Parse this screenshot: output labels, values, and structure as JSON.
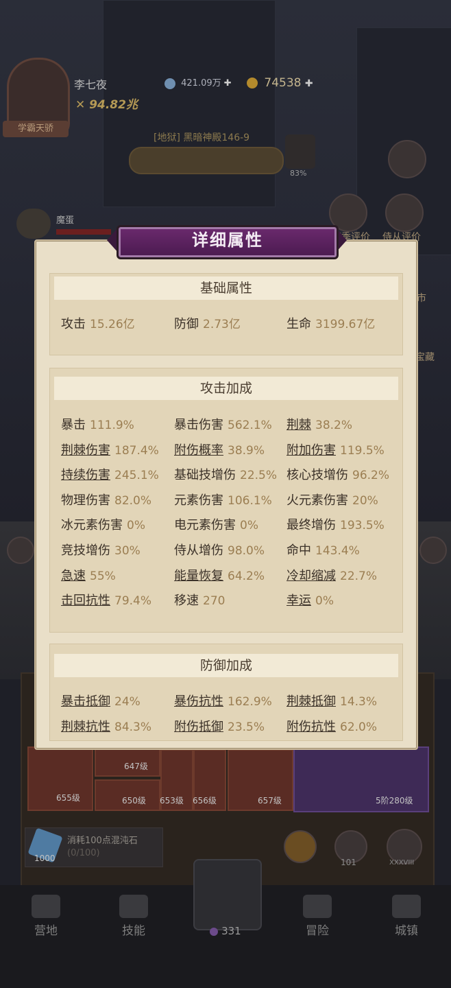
{
  "player": {
    "name": "李七夜",
    "power": "94.82兆",
    "badge": "学霸天骄"
  },
  "currency": {
    "diamond": "421.09万",
    "gold": "74538"
  },
  "stage": {
    "title": "[地狱] 黑暗神殿146-9",
    "progress_text": "83%"
  },
  "enemy": {
    "name": "魔蛋"
  },
  "side_labels": {
    "season": "赛季评价",
    "servant": "侍从评价",
    "shop": "市",
    "treasure": "宝藏"
  },
  "modal": {
    "title": "详细属性",
    "basic": {
      "heading": "基础属性",
      "stats": [
        {
          "label": "攻击",
          "value": "15.26亿"
        },
        {
          "label": "防御",
          "value": "2.73亿"
        },
        {
          "label": "生命",
          "value": "3199.67亿"
        }
      ]
    },
    "attack": {
      "heading": "攻击加成",
      "stats": [
        {
          "label": "暴击",
          "value": "111.9%"
        },
        {
          "label": "暴击伤害",
          "value": "562.1%"
        },
        {
          "label": "荆棘",
          "value": "38.2%"
        },
        {
          "label": "荆棘伤害",
          "value": "187.4%"
        },
        {
          "label": "附伤概率",
          "value": "38.9%"
        },
        {
          "label": "附加伤害",
          "value": "119.5%"
        },
        {
          "label": "持续伤害",
          "value": "245.1%"
        },
        {
          "label": "基础技增伤",
          "value": "22.5%"
        },
        {
          "label": "核心技增伤",
          "value": "96.2%"
        },
        {
          "label": "物理伤害",
          "value": "82.0%"
        },
        {
          "label": "元素伤害",
          "value": "106.1%"
        },
        {
          "label": "火元素伤害",
          "value": "20%"
        },
        {
          "label": "冰元素伤害",
          "value": "0%"
        },
        {
          "label": "电元素伤害",
          "value": "0%"
        },
        {
          "label": "最终增伤",
          "value": "193.5%"
        },
        {
          "label": "竞技增伤",
          "value": "30%"
        },
        {
          "label": "侍从增伤",
          "value": "98.0%"
        },
        {
          "label": "命中",
          "value": "143.4%"
        },
        {
          "label": "急速",
          "value": "55%"
        },
        {
          "label": "能量恢复",
          "value": "64.2%"
        },
        {
          "label": "冷却缩减",
          "value": "22.7%"
        },
        {
          "label": "击回抗性",
          "value": "79.4%"
        },
        {
          "label": "移速",
          "value": "270"
        },
        {
          "label": "幸运",
          "value": "0%"
        }
      ]
    },
    "defense": {
      "heading": "防御加成",
      "stats": [
        {
          "label": "暴击抵御",
          "value": "24%"
        },
        {
          "label": "暴伤抗性",
          "value": "162.9%"
        },
        {
          "label": "荆棘抵御",
          "value": "14.3%"
        },
        {
          "label": "荆棘抗性",
          "value": "84.3%"
        },
        {
          "label": "附伤抵御",
          "value": "23.5%"
        },
        {
          "label": "附伤抗性",
          "value": "62.0%"
        }
      ]
    }
  },
  "equipment": {
    "levels": [
      "655级",
      "647级",
      "650级",
      "653级",
      "656级",
      "657级"
    ],
    "wing_level": "5阶280级"
  },
  "cost": {
    "text": "消耗100点混沌石",
    "progress": "(0/100)",
    "count": "1000"
  },
  "buttons": {
    "gear_count": "101",
    "rank": "XXXVIII"
  },
  "nav": {
    "items": [
      {
        "label": "营地"
      },
      {
        "label": "技能"
      },
      {
        "label": "331"
      },
      {
        "label": "冒险"
      },
      {
        "label": "城镇"
      }
    ]
  }
}
